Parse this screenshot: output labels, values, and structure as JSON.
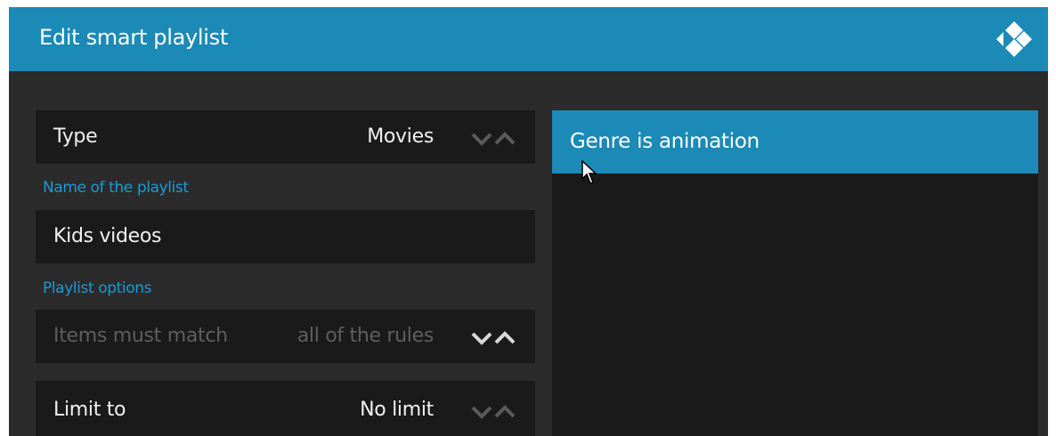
{
  "dialog": {
    "title": "Edit smart playlist",
    "logo_icon": "kodi-logo-icon"
  },
  "rows": {
    "type": {
      "label": "Type",
      "value": "Movies"
    },
    "name_section": "Name of the playlist",
    "name": {
      "value": "Kids videos"
    },
    "options_section": "Playlist options",
    "match": {
      "label": "Items must match",
      "value": "all of the rules",
      "disabled": true
    },
    "limit": {
      "label": "Limit to",
      "value": "No limit"
    }
  },
  "rules": {
    "items": [
      {
        "label": "Genre is animation",
        "selected": true
      }
    ]
  },
  "colors": {
    "accent": "#1b8ab6",
    "section_label": "#1b9ad3",
    "dialog_bg": "#2b2b2b",
    "row_bg": "#1a1a1a",
    "text": "#f0f0f0",
    "disabled_text": "#5e5e5e"
  }
}
